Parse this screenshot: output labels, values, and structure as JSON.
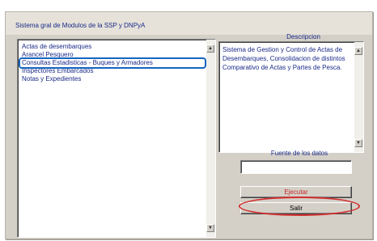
{
  "window": {
    "title": "Sistema gral de Modulos de la SSP y DNPyA"
  },
  "modules_list": {
    "items": [
      "Actas de desembarques",
      "Arancel Pesquero",
      "Consultas Estadisticas - Buques y Armadores",
      "Inspectores Embarcados",
      "Notas y Expedientes"
    ],
    "selected_index": 2
  },
  "description": {
    "label": "Descripcion",
    "text": "Sistema de Gestion y Control de Actas de Desembarques, Consolidacion de distintos Comparativo de Actas y Partes de Pesca."
  },
  "data_source": {
    "label": "Fuente de los datos",
    "value": ""
  },
  "buttons": {
    "run": "Ejecutar",
    "exit": "Salir"
  },
  "scrollbar": {
    "up_arrow": "▲",
    "down_arrow": "▼"
  },
  "colors": {
    "text_blue": "#1a2a88",
    "selection_outline": "#1565c0",
    "annotation_red": "#d32f2f",
    "run_text": "#c62828"
  }
}
